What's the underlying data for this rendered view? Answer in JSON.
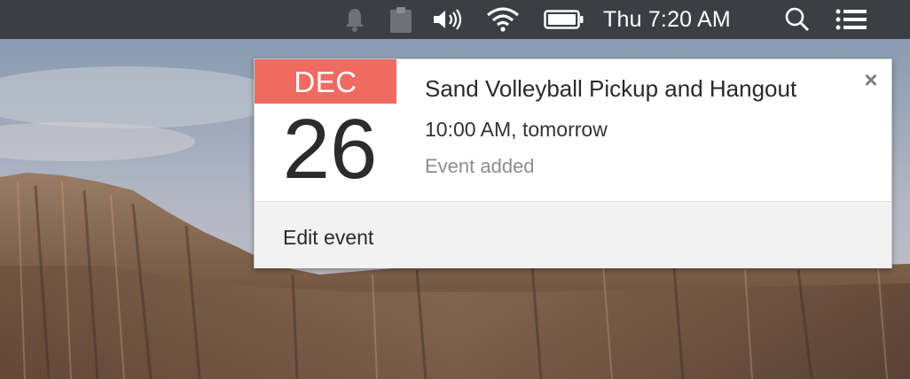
{
  "menubar": {
    "clock": "Thu 7:20 AM",
    "icons": [
      "notification-bell-icon",
      "clipboard-icon",
      "volume-icon",
      "wifi-icon",
      "battery-icon",
      "spotlight-search-icon",
      "notification-center-icon"
    ]
  },
  "notification": {
    "month": "DEC",
    "day": "26",
    "title": "Sand Volleyball Pickup and Hangout",
    "time": "10:00 AM, tomorrow",
    "status": "Event added",
    "close_label": "×",
    "action_label": "Edit event"
  },
  "colors": {
    "menubar": "#3b3f45",
    "calendar_accent": "#ef6b61",
    "footer": "#f2f2f2"
  }
}
